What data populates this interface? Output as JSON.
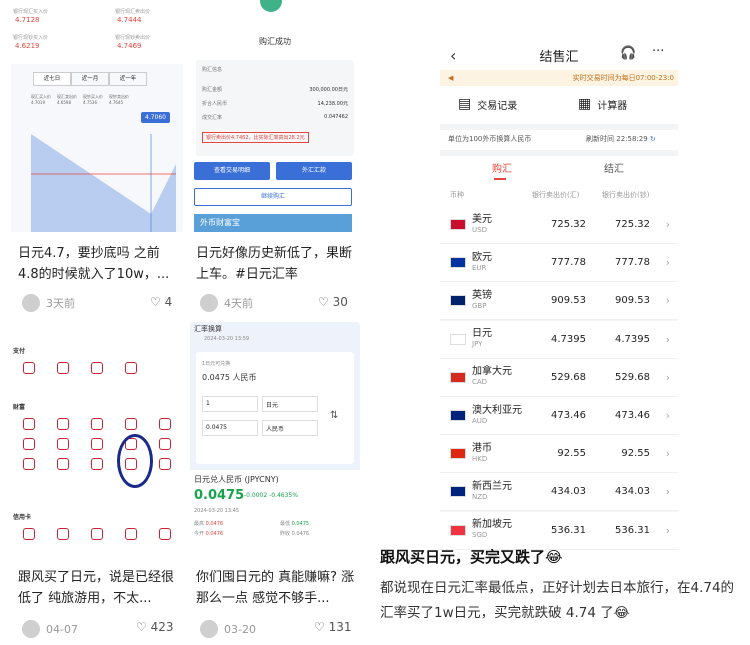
{
  "feed": {
    "card1": {
      "top_labels": [
        "银行现汇买入价",
        "银行现汇卖出价",
        "银行现钞买入价",
        "银行现钞卖出价"
      ],
      "top_values": [
        "4.7128",
        "4.7444",
        "4.6219",
        "4.7469"
      ],
      "tabs": [
        "近七日",
        "近一月",
        "近一年"
      ],
      "legend_labels": [
        "现汇买入价",
        "现汇卖出价",
        "现钞买入价",
        "现钞卖出价"
      ],
      "legend_values": [
        "4.7019",
        "4.6598",
        "4.7536",
        "4.7645"
      ],
      "tooltip_value": "4.7060",
      "caption": "日元4.7，要抄底吗 之前4.8的时候就入了10w，...",
      "meta": "3天前",
      "likes": "4"
    },
    "card2": {
      "title": "购汇成功",
      "section": "购汇信息",
      "fields": [
        [
          "购汇金额",
          "300,000.00日元"
        ],
        [
          "折合人民币",
          "14,238.00元"
        ],
        [
          "成交汇率",
          "0.047462"
        ]
      ],
      "note": "银行卖出价4.7462，比实际汇率高出28.2元",
      "btn_detail": "查看交易明细",
      "btn_transfer": "外汇汇款",
      "btn_continue": "继续购汇",
      "banner": "外币财富宝",
      "caption": "日元好像历史新低了，果断上车。#日元汇率",
      "meta": "4天前",
      "likes": "30"
    },
    "card3": {
      "pay_label": "支付",
      "wealth_label": "财富",
      "credit_label": "信用卡",
      "caption": "跟风买了日元，说是已经很低了 纯旅游用，不太...",
      "meta": "04-07",
      "likes": "423"
    },
    "card4": {
      "header": "汇率换算",
      "time": "2024-03-20 13:59",
      "calc_label": "1日元可兑换",
      "calc_result": "0.0475 人民币",
      "input1": "1",
      "cur1": "日元",
      "input2": "0.0475",
      "cur2": "人民币",
      "pair": "日元兑人民币 (JPYCNY)",
      "price": "0.0475",
      "change": "-0.0002 -0.4635%",
      "timestamp": "2024-03-20 13:45",
      "stats": [
        [
          "最高",
          "0.0476"
        ],
        [
          "最低",
          "0.0475"
        ],
        [
          "今开",
          "0.0476"
        ],
        [
          "昨收",
          "0.0476"
        ]
      ],
      "caption": "你们囤日元的 真能赚嘛? 涨那么一点 感觉不够手...",
      "meta": "03-20",
      "likes": "131"
    }
  },
  "app": {
    "title": "结售汇",
    "back_icon": "back-arrow-icon",
    "headset_icon": "headset-icon",
    "more_icon": "more-icon",
    "notice": "实时交易时间为每日07:00-23:0",
    "trade_records": "交易记录",
    "calculator": "计算器",
    "unit_note": "单位为100外币换算人民币",
    "refresh_label": "刷新时间",
    "refresh_time": "22:58:29",
    "tabs": [
      "购汇",
      "结汇"
    ],
    "columns": [
      "币种",
      "银行卖出价(汇)",
      "银行卖出价(钞)"
    ],
    "rows": [
      {
        "name": "美元",
        "code": "USD",
        "v1": "725.32",
        "v2": "725.32"
      },
      {
        "name": "欧元",
        "code": "EUR",
        "v1": "777.78",
        "v2": "777.78"
      },
      {
        "name": "英镑",
        "code": "GBP",
        "v1": "909.53",
        "v2": "909.53"
      },
      {
        "name": "日元",
        "code": "JPY",
        "v1": "4.7395",
        "v2": "4.7395"
      },
      {
        "name": "加拿大元",
        "code": "CAD",
        "v1": "529.68",
        "v2": "529.68"
      },
      {
        "name": "澳大利亚元",
        "code": "AUD",
        "v1": "473.46",
        "v2": "473.46"
      },
      {
        "name": "港币",
        "code": "HKD",
        "v1": "92.55",
        "v2": "92.55"
      },
      {
        "name": "新西兰元",
        "code": "NZD",
        "v1": "434.03",
        "v2": "434.03"
      },
      {
        "name": "新加坡元",
        "code": "SGD",
        "v1": "536.31",
        "v2": "536.31"
      }
    ]
  },
  "post": {
    "title": "跟风买日元，买完又跌了😂",
    "body": "都说现在日元汇率最低点，正好计划去日本旅行，在4.74的汇率买了1w日元，买完就跌破 4.74 了😂"
  },
  "colors": {
    "accent": "#e8453c",
    "green": "#17a34a",
    "blue": "#3a6fd8"
  }
}
